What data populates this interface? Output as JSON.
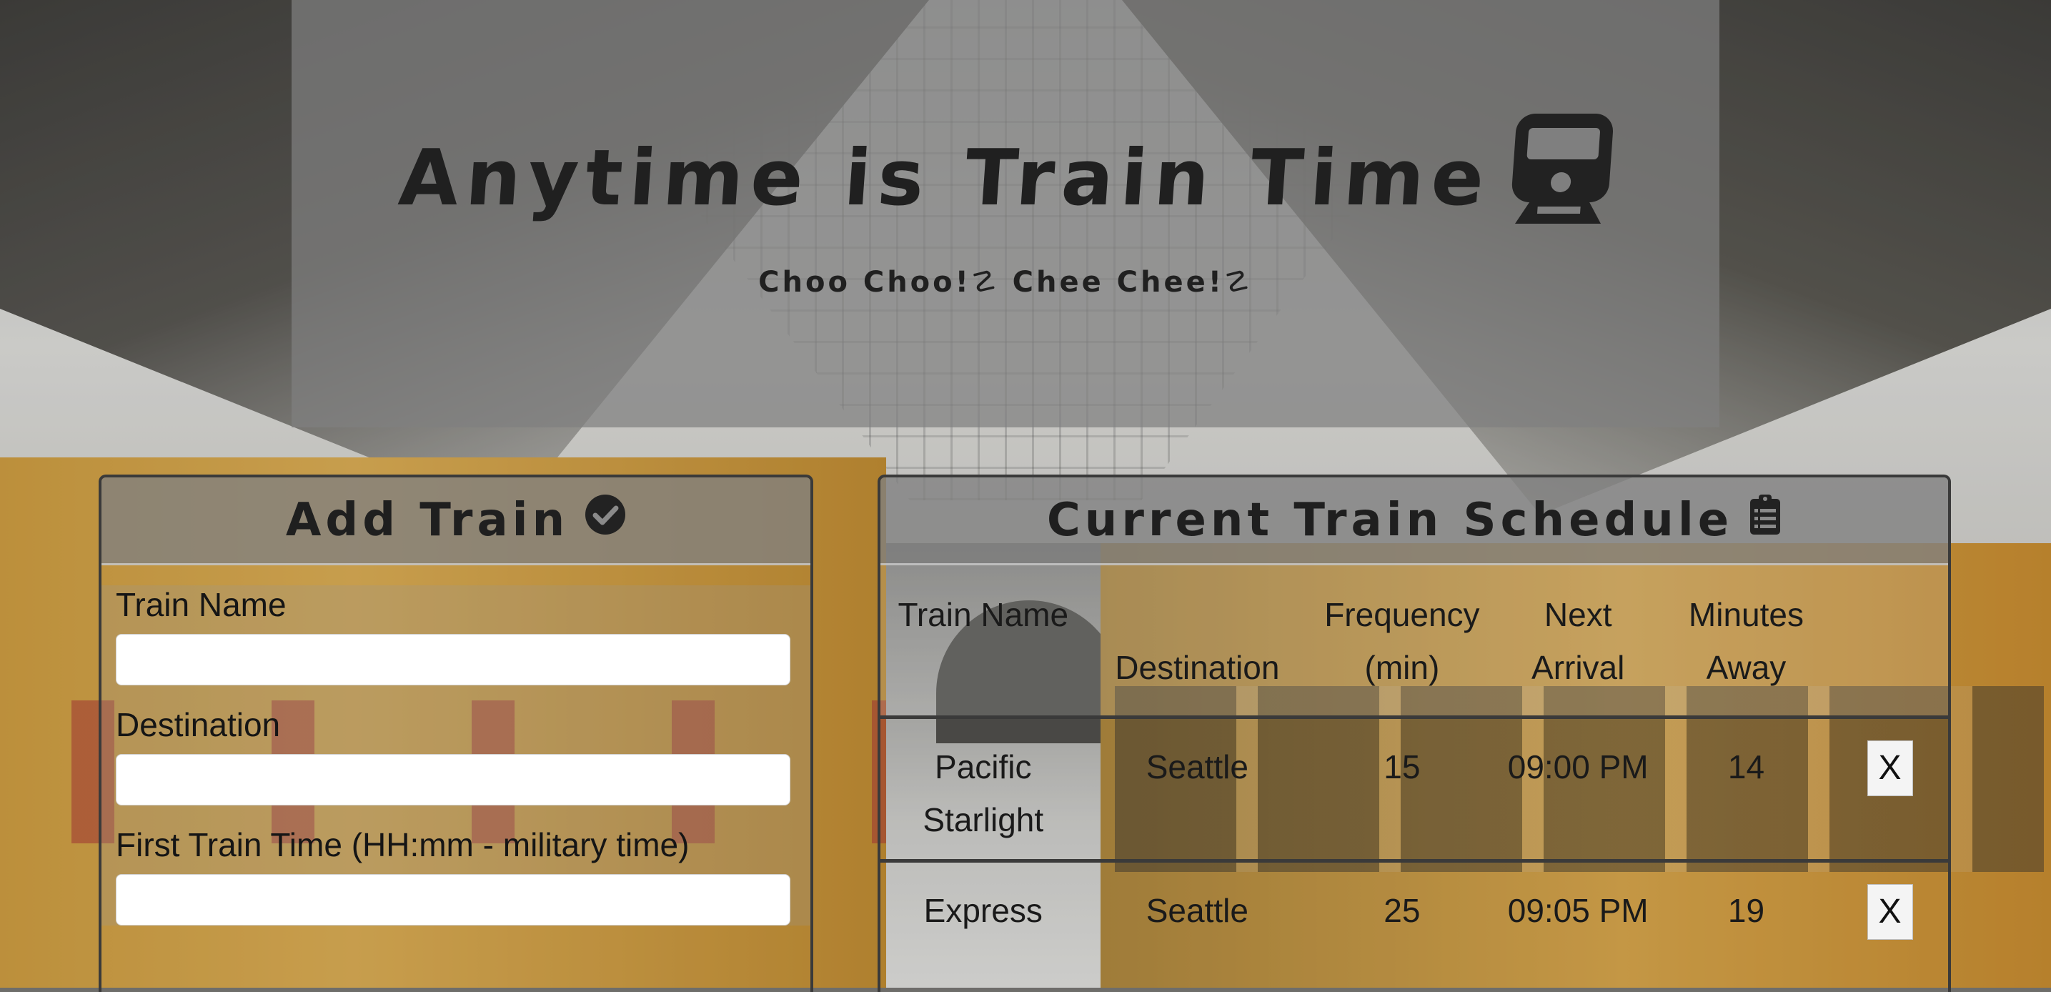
{
  "header": {
    "title": "Anytime is Train Time",
    "title_icon": "train-icon",
    "subtitle": "Choo Choo!☡ Chee Chee!☡"
  },
  "add_panel": {
    "heading": "Add Train",
    "heading_icon": "check-circle-icon",
    "fields": [
      {
        "label": "Train Name",
        "value": "",
        "placeholder": ""
      },
      {
        "label": "Destination",
        "value": "",
        "placeholder": ""
      },
      {
        "label": "First Train Time (HH:mm - military time)",
        "value": "",
        "placeholder": ""
      }
    ]
  },
  "schedule_panel": {
    "heading": "Current Train Schedule",
    "heading_icon": "clipboard-list-icon",
    "columns": [
      "Train Name",
      "Destination",
      "Frequency (min)",
      "Next Arrival",
      "Minutes Away",
      ""
    ],
    "rows": [
      {
        "train_name": "Pacific Starlight",
        "destination": "Seattle",
        "frequency": "15",
        "next_arrival": "09:00 PM",
        "minutes_away": "14",
        "delete_label": "X"
      },
      {
        "train_name": "Express",
        "destination": "Seattle",
        "frequency": "25",
        "next_arrival": "09:05 PM",
        "minutes_away": "19",
        "delete_label": "X"
      }
    ]
  }
}
